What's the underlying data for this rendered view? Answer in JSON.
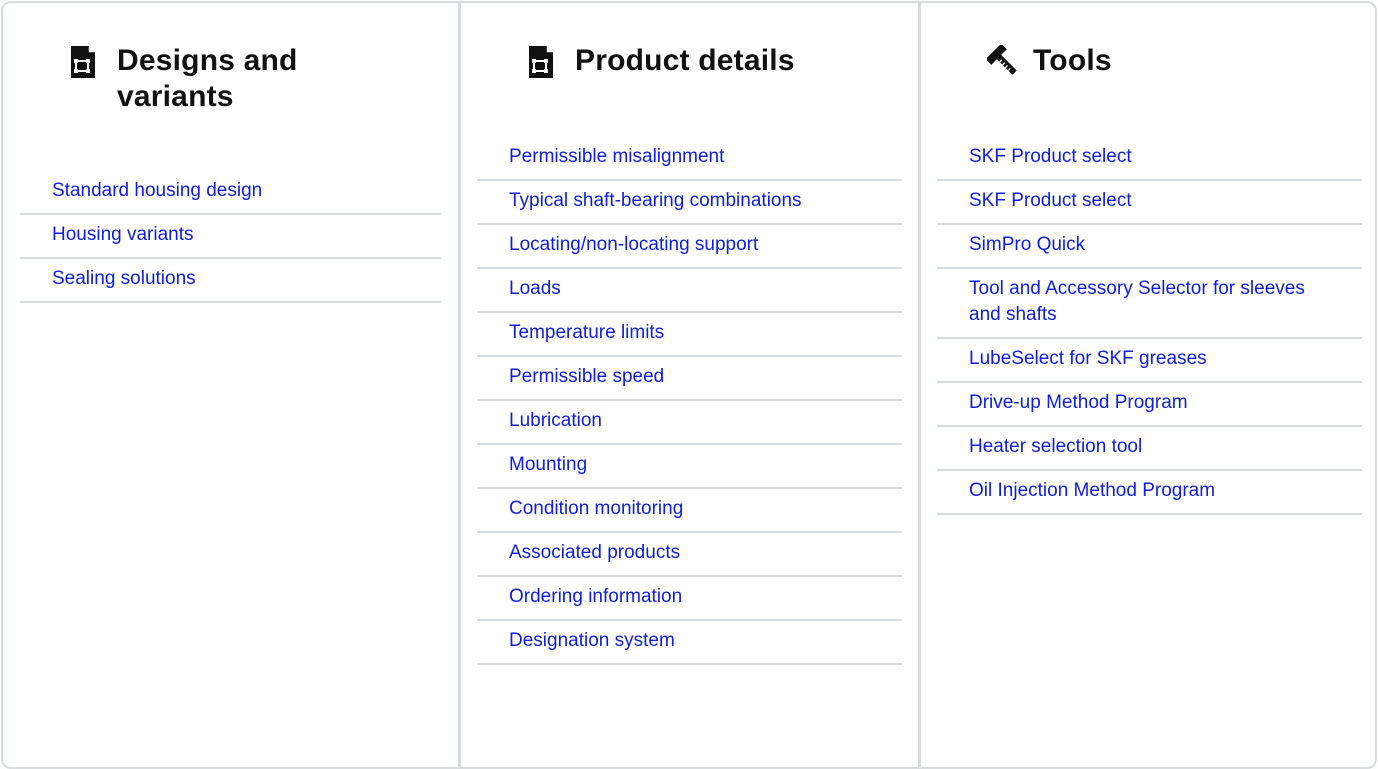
{
  "columns": [
    {
      "title": "Designs and variants",
      "icon": "document-drawing-icon",
      "links": [
        "Standard housing design",
        "Housing variants",
        "Sealing solutions"
      ]
    },
    {
      "title": "Product details",
      "icon": "document-drawing-icon",
      "links": [
        "Permissible misalignment",
        "Typical shaft-bearing combinations",
        "Locating/non-locating support",
        "Loads",
        "Temperature limits",
        "Permissible speed",
        "Lubrication",
        "Mounting",
        "Condition monitoring",
        "Associated products",
        "Ordering information",
        "Designation system"
      ]
    },
    {
      "title": "Tools",
      "icon": "hammer-ruler-icon",
      "links": [
        "SKF Product select",
        "SKF Product select",
        "SimPro Quick",
        "Tool and Accessory Selector for sleeves and shafts",
        "LubeSelect for SKF greases",
        "Drive-up Method Program",
        "Heater selection tool",
        "Oil Injection Method Program"
      ]
    }
  ],
  "colors": {
    "link": "#0f1ed8",
    "heading": "#111111",
    "divider": "#d9dcdf"
  }
}
